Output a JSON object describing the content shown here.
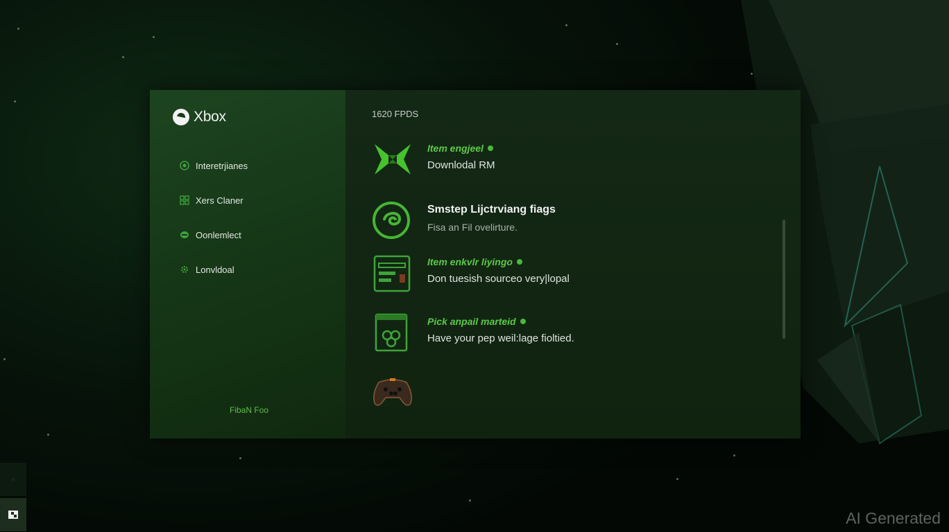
{
  "brand": {
    "name": "Xbox"
  },
  "sidebar": {
    "items": [
      {
        "label": "Interetrjianes",
        "icon": "circle-icon"
      },
      {
        "label": "Xers Claner",
        "icon": "grid-icon"
      },
      {
        "label": "Oonlemlect",
        "icon": "controller-icon"
      },
      {
        "label": "Lonvldoal",
        "icon": "gear-icon"
      }
    ],
    "footer": "FibaN Foo"
  },
  "main": {
    "header": "1620 FPDS",
    "items": [
      {
        "title": "Item engjeel",
        "subtitle": "Downlodal RM",
        "icon": "xbox-emblem-icon",
        "badge": true
      },
      {
        "title": "Smstep Lijctrviang fiags",
        "subtitle": "Fisa an Fil ovelirture.",
        "icon": "swirl-icon",
        "badge": false
      },
      {
        "title": "Item enkvlr liyingo",
        "subtitle": "Don tuesish sourceo very|lopal",
        "icon": "console-icon",
        "badge": true
      },
      {
        "title": "Pick anpail marteid",
        "subtitle": "Have your pep weil:lage fioltied.",
        "icon": "document-icon",
        "badge": true
      },
      {
        "title": "",
        "subtitle": "",
        "icon": "gamepad-icon",
        "badge": false
      }
    ]
  },
  "watermark": "AI Generated",
  "colors": {
    "accent": "#5cc94a",
    "sidebar": "#1a3f1c",
    "content": "#12250f"
  }
}
